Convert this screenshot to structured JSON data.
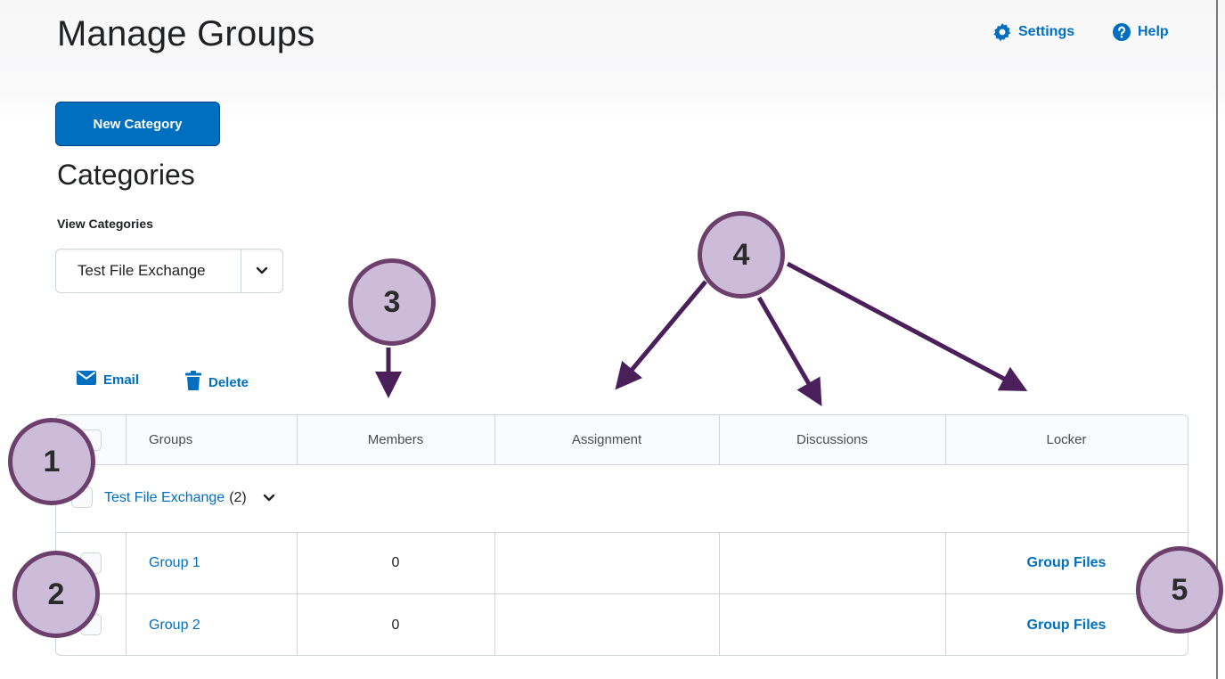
{
  "header": {
    "title": "Manage Groups",
    "settings_label": "Settings",
    "help_label": "Help"
  },
  "toolbar": {
    "new_category_label": "New Category"
  },
  "categories": {
    "heading": "Categories",
    "view_label": "View Categories",
    "selected": "Test File Exchange"
  },
  "actions": {
    "email_label": "Email",
    "delete_label": "Delete"
  },
  "table": {
    "headers": {
      "groups": "Groups",
      "members": "Members",
      "assignment": "Assignment",
      "discussions": "Discussions",
      "locker": "Locker"
    },
    "category_row": {
      "name": "Test File Exchange",
      "count": "(2)"
    },
    "rows": [
      {
        "group": "Group 1",
        "members": "0",
        "assignment": "",
        "discussions": "",
        "locker": "Group Files"
      },
      {
        "group": "Group 2",
        "members": "0",
        "assignment": "",
        "discussions": "",
        "locker": "Group Files"
      }
    ]
  },
  "callouts": {
    "one": "1",
    "two": "2",
    "three": "3",
    "four": "4",
    "five": "5",
    "bubble_fill": "#cdbcd9",
    "bubble_border": "#6d3f6d",
    "arrow_color": "#4b1f5a"
  },
  "colors": {
    "accent": "#006fbf",
    "border": "#cdd5dc",
    "text": "#202122"
  },
  "icons": [
    "gear-icon",
    "help-icon",
    "email-icon",
    "trash-icon",
    "chevron-down-icon"
  ]
}
